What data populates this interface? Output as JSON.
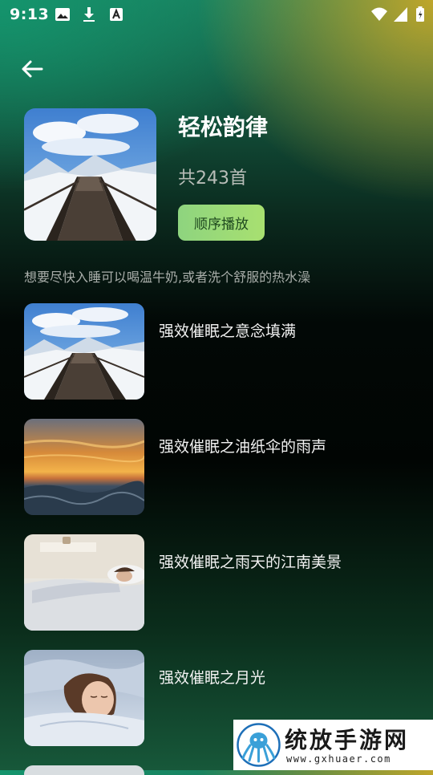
{
  "status_bar": {
    "time": "9:13",
    "left_icons": [
      "image-icon",
      "download-icon",
      "text-a-icon"
    ],
    "right_icons": [
      "wifi-icon",
      "signal-icon",
      "battery-icon"
    ]
  },
  "header": {
    "back_icon": "arrow-left-icon"
  },
  "album": {
    "title": "轻松韵律",
    "count": "共243首",
    "play_label": "顺序播放",
    "description": "想要尽快入睡可以喝温牛奶,或者洗个舒服的热水澡",
    "cover_image": "snowy-boardwalk"
  },
  "tracks": [
    {
      "title": "强效催眠之意念填满",
      "image": "snowy-boardwalk"
    },
    {
      "title": "强效催眠之油纸伞的雨声",
      "image": "ocean-sunset"
    },
    {
      "title": "强效催眠之雨天的江南美景",
      "image": "woman-sleeping"
    },
    {
      "title": "强效催眠之月光",
      "image": "girl-sleeping"
    }
  ],
  "watermark": {
    "name": "统放手游网",
    "url": "www.gxhuaer.com"
  },
  "colors": {
    "play_button": "#9ddb78",
    "play_text": "#1f4a1f",
    "muted_text": "#a9aeaa"
  }
}
